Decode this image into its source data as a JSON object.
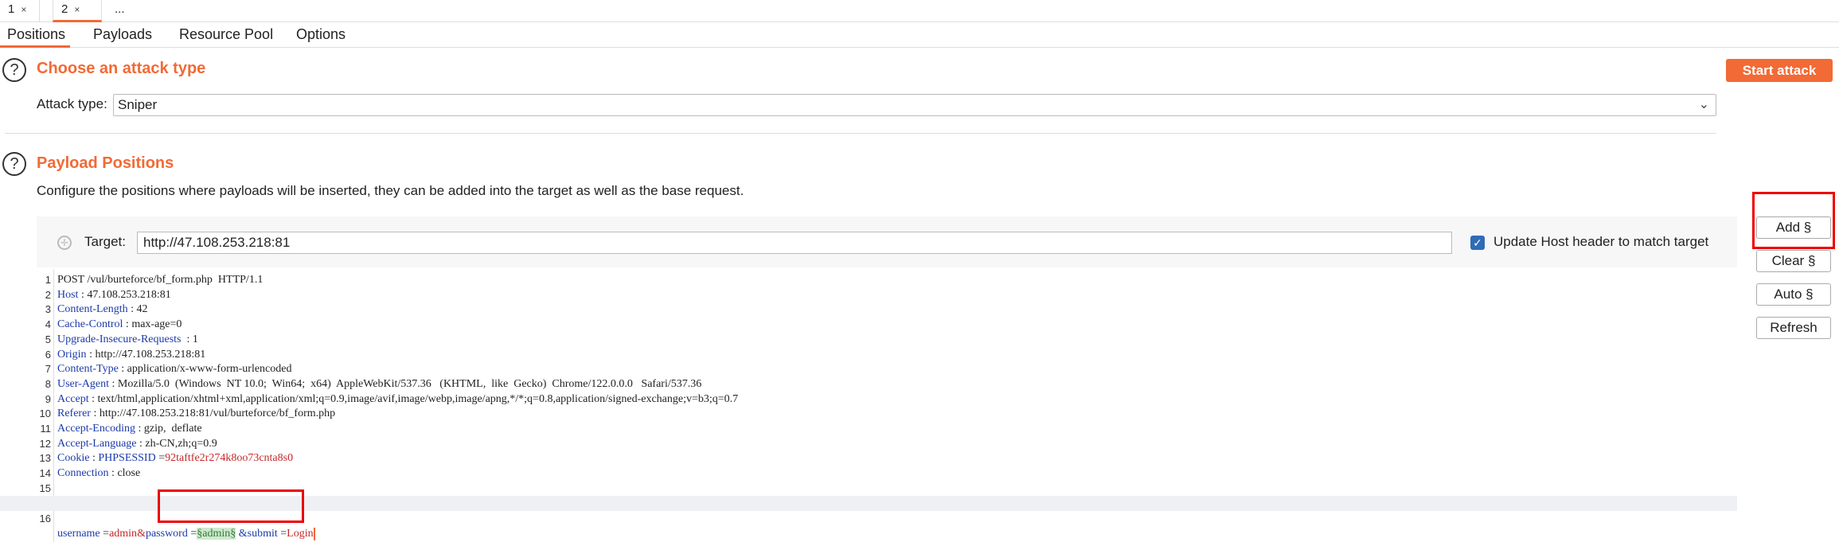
{
  "request_tabs": [
    {
      "label": "1",
      "close": "×"
    },
    {
      "label": "2",
      "close": "×"
    },
    {
      "label": "..."
    }
  ],
  "sub_tabs": [
    "Positions",
    "Payloads",
    "Resource Pool",
    "Options"
  ],
  "attack_section": {
    "help": "?",
    "title": "Choose an attack type",
    "start_button": "Start attack",
    "attack_type_label": "Attack type:",
    "attack_type_value": "Sniper",
    "chevron_icon": "chevron-down-icon"
  },
  "positions_section": {
    "help": "?",
    "title": "Payload Positions",
    "description": "Configure the positions where payloads will be inserted, they can be added into the target as well as the base request.",
    "target_label": "Target:",
    "target_value": "http://47.108.253.218:81",
    "update_host_checked": true,
    "update_host_label": "Update Host header to match target"
  },
  "side_buttons": [
    "Add §",
    "Clear §",
    "Auto §",
    "Refresh"
  ],
  "request_lines": [
    {
      "n": "1",
      "key": "",
      "sep": "",
      "val": "POST /vul/burteforce/bf_form.php  HTTP/1.1"
    },
    {
      "n": "2",
      "key": "Host",
      "sep": " : ",
      "val": "47.108.253.218:81"
    },
    {
      "n": "3",
      "key": "Content-Length",
      "sep": " : ",
      "val": "42"
    },
    {
      "n": "4",
      "key": "Cache-Control",
      "sep": " : ",
      "val": "max-age=0"
    },
    {
      "n": "5",
      "key": "Upgrade-Insecure-Requests",
      "sep": "  : ",
      "val": "1"
    },
    {
      "n": "6",
      "key": "Origin",
      "sep": " : ",
      "val": "http://47.108.253.218:81"
    },
    {
      "n": "7",
      "key": "Content-Type",
      "sep": " : ",
      "val": "application/x-www-form-urlencoded"
    },
    {
      "n": "8",
      "key": "User-Agent",
      "sep": " : ",
      "val": "Mozilla/5.0  (Windows  NT 10.0;  Win64;  x64)  AppleWebKit/537.36   (KHTML,  like  Gecko)  Chrome/122.0.0.0   Safari/537.36"
    },
    {
      "n": "9",
      "key": "Accept",
      "sep": " : ",
      "val": "text/html,application/xhtml+xml,application/xml;q=0.9,image/avif,image/webp,image/apng,*/*;q=0.8,application/signed-exchange;v=b3;q=0.7"
    },
    {
      "n": "10",
      "key": "Referer",
      "sep": " : ",
      "val": "http://47.108.253.218:81/vul/burteforce/bf_form.php"
    },
    {
      "n": "11",
      "key": "Accept-Encoding",
      "sep": " : ",
      "val": "gzip,  deflate"
    },
    {
      "n": "12",
      "key": "Accept-Language",
      "sep": " : ",
      "val": "zh-CN,zh;q=0.9"
    },
    {
      "n": "13",
      "key": "Cookie",
      "sep": " : ",
      "val": ""
    },
    {
      "n": "14",
      "key": "Connection",
      "sep": " : ",
      "val": "close"
    },
    {
      "n": "15",
      "key": "",
      "sep": "",
      "val": ""
    }
  ],
  "cookie": {
    "name": "PHPSESSID",
    "eq": " =",
    "value": "92taftfe2r274k8oo73cnta8s0"
  },
  "body_line": {
    "n": "16",
    "k1": "username",
    "eq1": " =",
    "v1": "admin",
    "amp1": "&",
    "k2": "password",
    "eq2": " =",
    "marked": "§admin§",
    "amp2": " &",
    "k3": "submit",
    "eq3": " =",
    "v3": "Login"
  }
}
